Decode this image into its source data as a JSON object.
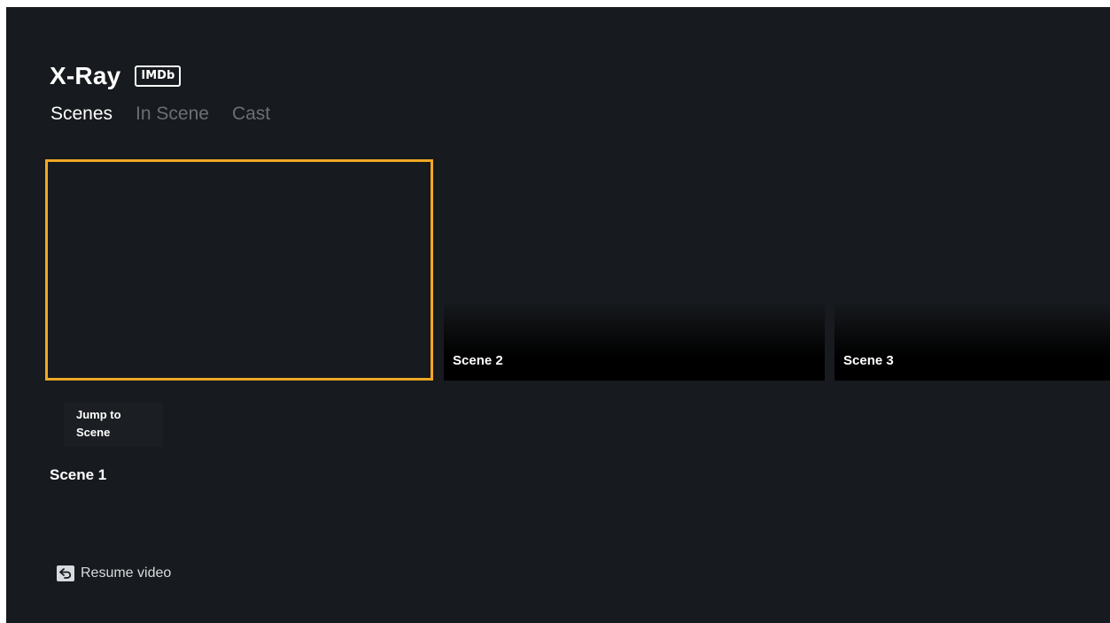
{
  "header": {
    "title": "X-Ray",
    "badge": "IMDb"
  },
  "tabs": [
    {
      "label": "Scenes",
      "active": true
    },
    {
      "label": "In Scene",
      "active": false
    },
    {
      "label": "Cast",
      "active": false
    }
  ],
  "scenes": [
    {
      "label": "Scene 1",
      "focused": true
    },
    {
      "label": "Scene 2",
      "focused": false
    },
    {
      "label": "Scene 3",
      "focused": false
    }
  ],
  "jump_button": {
    "line1": "Jump to",
    "line2": "Scene"
  },
  "footer": {
    "resume_label": "Resume video",
    "icon": "back-button-icon"
  },
  "colors": {
    "background": "#171a1e",
    "focus": "#f0a823",
    "inactive_tab": "#6b6f75"
  }
}
